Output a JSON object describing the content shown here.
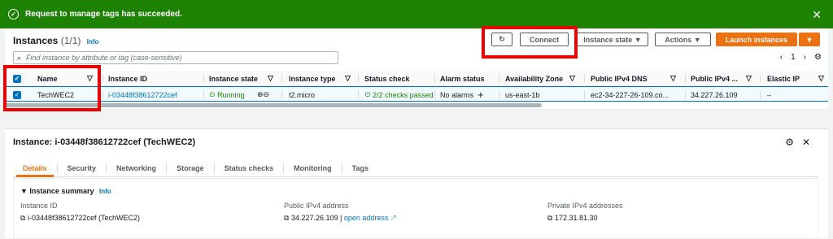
{
  "flash": {
    "message": "Request to manage tags has succeeded."
  },
  "instances": {
    "title": "Instances",
    "count": "(1/1)",
    "info": "Info",
    "buttons": {
      "connect": "Connect",
      "instance_state": "Instance state",
      "actions": "Actions",
      "launch": "Launch instances"
    },
    "search_placeholder": "Find instance by attribute or tag (case-sensitive)",
    "page": "1",
    "columns": [
      "Name",
      "Instance ID",
      "Instance state",
      "Instance type",
      "Status check",
      "Alarm status",
      "Availability Zone",
      "Public IPv4 DNS",
      "Public IPv4 ...",
      "Elastic IP"
    ],
    "row": {
      "name": "TechWEC2",
      "id": "i-03448f38612722cef",
      "state": "Running",
      "type": "t2.micro",
      "status": "2/2 checks passed",
      "alarm": "No alarms",
      "az": "us-east-1b",
      "dns": "ec2-34-227-26-109.co...",
      "ip": "34.227.26.109",
      "eip": "–"
    }
  },
  "detail": {
    "title": "Instance: i-03448f38612722cef (TechWEC2)",
    "tabs": [
      "Details",
      "Security",
      "Networking",
      "Storage",
      "Status checks",
      "Monitoring",
      "Tags"
    ],
    "summary_title": "Instance summary",
    "info": "Info",
    "fields": {
      "id_label": "Instance ID",
      "id_value": "i-03448f38612722cef (TechWEC2)",
      "pub_label": "Public IPv4 address",
      "pub_value": "34.227.26.109",
      "open": "open address",
      "priv_label": "Private IPv4 addresses",
      "priv_value": "172.31.81.30"
    }
  },
  "colors": {
    "accent": "#ec7211",
    "link": "#0073bb",
    "success": "#1d8102"
  }
}
